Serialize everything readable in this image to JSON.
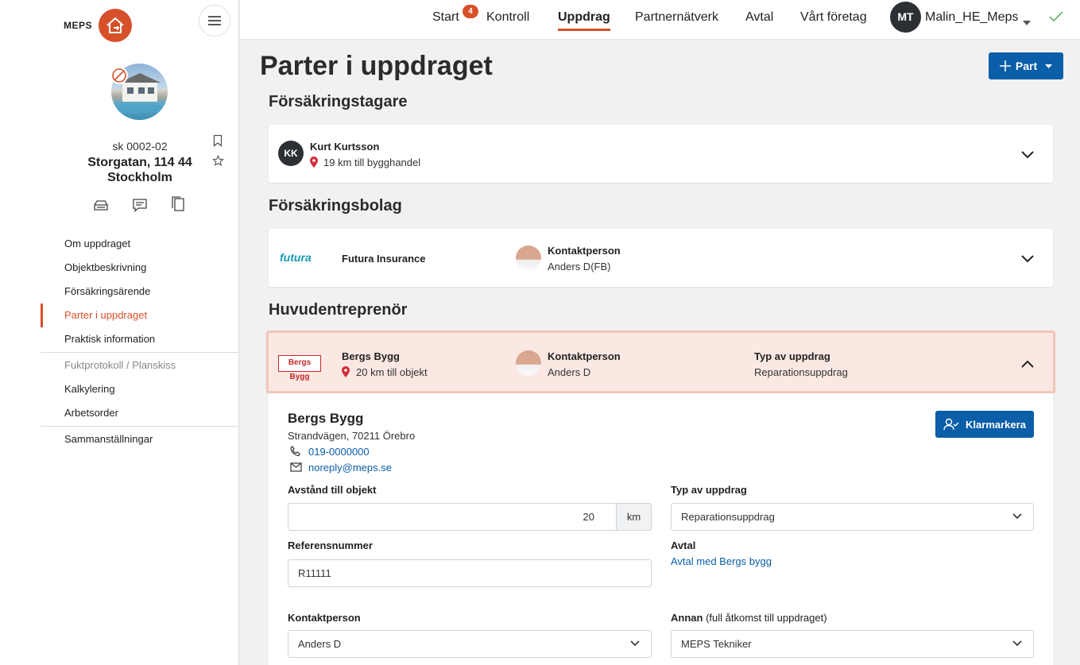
{
  "app": {
    "logo_text": "MEPS"
  },
  "sidebar": {
    "object_id": "sk 0002-02",
    "address_line1": "Storgatan, 114 44",
    "address_line2": "Stockholm",
    "nav": [
      {
        "label": "Om uppdraget"
      },
      {
        "label": "Objektbeskrivning"
      },
      {
        "label": "Försäkringsärende"
      },
      {
        "label": "Parter i uppdraget"
      },
      {
        "label": "Praktisk information"
      },
      {
        "label": "Fuktprotokoll / Planskiss"
      },
      {
        "label": "Kalkylering"
      },
      {
        "label": "Arbetsorder"
      },
      {
        "label": "Sammanställningar"
      }
    ]
  },
  "topnav": {
    "items": [
      "Start",
      "Kontroll",
      "Uppdrag",
      "Partnernätverk",
      "Avtal",
      "Vårt företag"
    ],
    "start_badge": "4",
    "user_initials": "MT",
    "user_name": "Malin_HE_Meps"
  },
  "page": {
    "title": "Parter i uppdraget",
    "add_button": "Part"
  },
  "sections": {
    "insured": {
      "title": "Försäkringstagare",
      "initials": "KK",
      "name": "Kurt Kurtsson",
      "distance": "19 km till bygghandel"
    },
    "insurer": {
      "title": "Försäkringsbolag",
      "logo": "futura",
      "company": "Futura Insurance",
      "contact_label": "Kontaktperson",
      "contact_name": "Anders D(FB)"
    },
    "contractor": {
      "title": "Huvudentreprenör",
      "logo": "Bergs Bygg",
      "company": "Bergs Bygg",
      "distance": "20 km till objekt",
      "contact_label": "Kontaktperson",
      "contact_name": "Anders D",
      "type_label": "Typ av uppdrag",
      "type_value": "Reparationsuppdrag"
    }
  },
  "detail": {
    "company": "Bergs Bygg",
    "address": "Strandvägen, 70211 Örebro",
    "phone": "019-0000000",
    "email": "noreply@meps.se",
    "mark_button": "Klarmarkera",
    "distance_label": "Avstånd till objekt",
    "distance_value": "20",
    "distance_unit": "km",
    "type_label": "Typ av uppdrag",
    "type_value": "Reparationsuppdrag",
    "ref_label": "Referensnummer",
    "ref_value": "R11111",
    "agreement_label": "Avtal",
    "agreement_link": "Avtal med Bergs bygg",
    "contact_label": "Kontaktperson",
    "contact_value": "Anders D",
    "other_label": "Annan",
    "other_label_suffix": "(full åtkomst till uppdraget)",
    "other_value": "MEPS Tekniker"
  },
  "colors": {
    "accent": "#d6502a",
    "primary": "#0b5ea8",
    "highlight": "#fbe8e3"
  }
}
